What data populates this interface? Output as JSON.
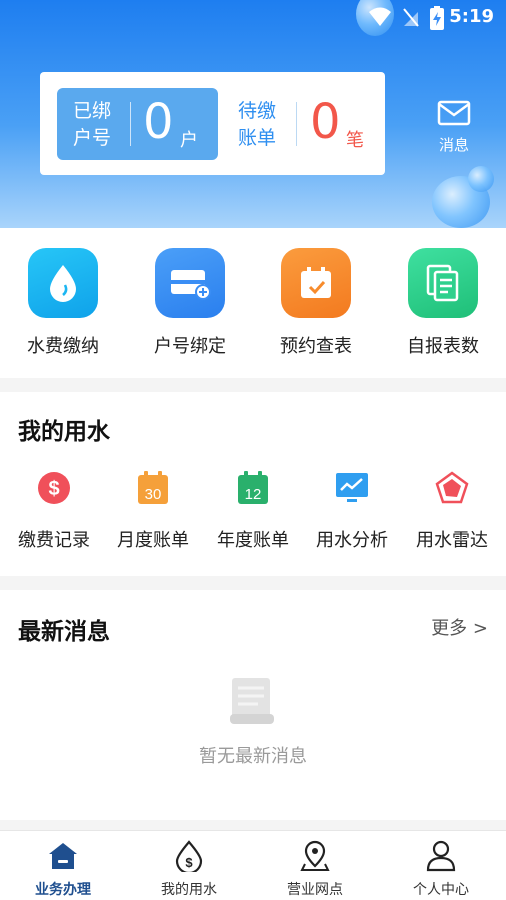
{
  "status_bar": {
    "time": "5:19"
  },
  "account": {
    "bound_label": "已绑户号",
    "bound_count": "0",
    "bound_unit": "户",
    "pending_label": "待缴账单",
    "pending_count": "0",
    "pending_unit": "笔"
  },
  "message_button": {
    "label": "消息",
    "icon": "mail-icon"
  },
  "services": [
    {
      "label": "水费缴纳",
      "icon": "water-drop-icon",
      "color": "#1cb6f2"
    },
    {
      "label": "户号绑定",
      "icon": "card-add-icon",
      "color": "#3a8ef5"
    },
    {
      "label": "预约查表",
      "icon": "calendar-check-icon",
      "color": "#f78b2c"
    },
    {
      "label": "自报表数",
      "icon": "document-copy-icon",
      "color": "#2fd08d"
    }
  ],
  "my_water": {
    "title": "我的用水",
    "items": [
      {
        "label": "缴费记录",
        "icon": "dollar-icon",
        "color": "#f0505a"
      },
      {
        "label": "月度账单",
        "icon": "calendar-30-icon",
        "color": "#f5a03a",
        "day": "30"
      },
      {
        "label": "年度账单",
        "icon": "calendar-12-icon",
        "color": "#2ab06c",
        "day": "12"
      },
      {
        "label": "用水分析",
        "icon": "chart-monitor-icon",
        "color": "#2f9ef0"
      },
      {
        "label": "用水雷达",
        "icon": "radar-icon",
        "color": "#f0505a"
      }
    ]
  },
  "news": {
    "title": "最新消息",
    "more": "更多 >",
    "empty_text": "暂无最新消息"
  },
  "bottom_nav": [
    {
      "label": "业务办理",
      "icon": "home-icon",
      "active": true
    },
    {
      "label": "我的用水",
      "icon": "water-dollar-icon",
      "active": false
    },
    {
      "label": "营业网点",
      "icon": "location-pin-icon",
      "active": false
    },
    {
      "label": "个人中心",
      "icon": "person-icon",
      "active": false
    }
  ]
}
